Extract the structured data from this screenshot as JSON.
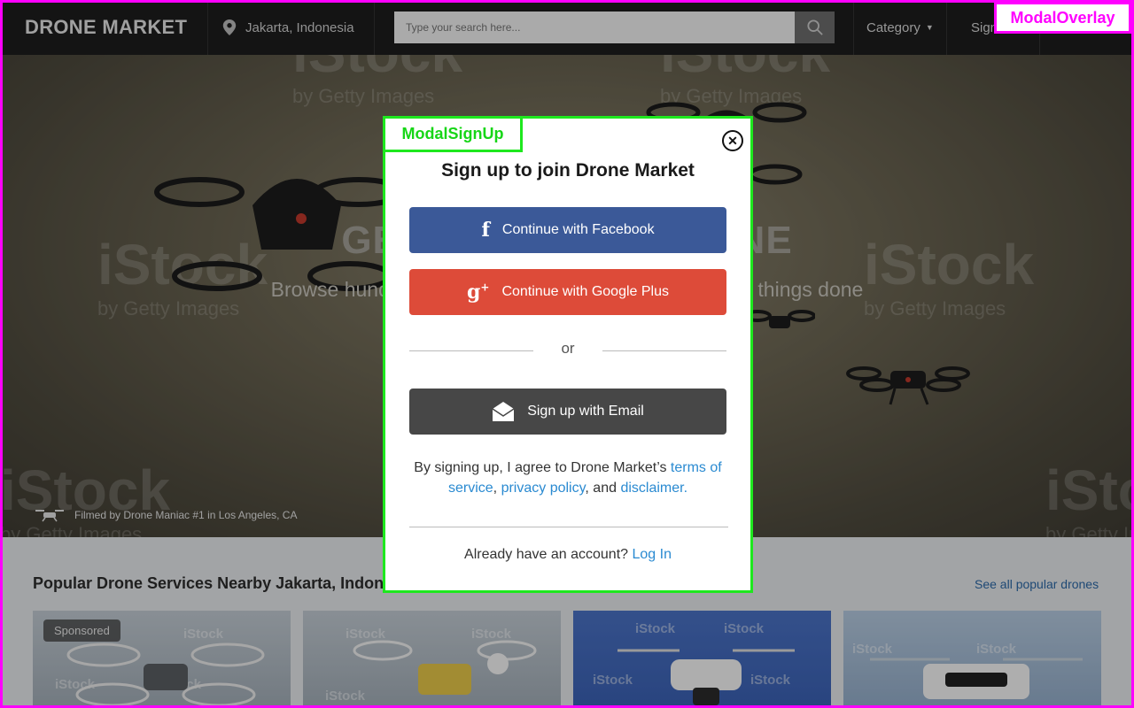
{
  "nav": {
    "brand": "DRONE MARKET",
    "location": "Jakarta, Indonesia",
    "search_placeholder": "Type your search here...",
    "category": "Category",
    "sign": "Sign"
  },
  "hero": {
    "title": "GET THE BEST DRONE",
    "subtitle": "Browse hundreds of drones and hire them to get your things done",
    "credit": "Filmed by Drone Maniac #1 in Los Angeles, CA",
    "watermark": "iStock",
    "watermark_sub": "by Getty Images"
  },
  "popular": {
    "title": "Popular Drone Services Nearby Jakarta, Indonesia",
    "see_all": "See all popular drones",
    "sponsored": "Sponsored"
  },
  "overlay": {
    "tag": "ModalOverlay"
  },
  "modal": {
    "tag": "ModalSignUp",
    "close_glyph": "✕",
    "title": "Sign up to join Drone Market",
    "facebook": "Continue with Facebook",
    "google": "Continue with Google Plus",
    "or": "or",
    "email": "Sign up with Email",
    "terms_prefix": "By signing up, I agree to Drone Market’s ",
    "terms_link": "terms of service",
    "comma": ", ",
    "privacy_link": "privacy policy",
    "and": ", and ",
    "disclaimer_link": "disclaimer.",
    "already": "Already have an account? ",
    "login": "Log In"
  },
  "colors": {
    "facebook": "#3b5998",
    "google": "#dd4b39",
    "email": "#474747",
    "link": "#2a8ad1",
    "overlay_tag": "#ff00ff",
    "modal_tag": "#1ee81e"
  }
}
